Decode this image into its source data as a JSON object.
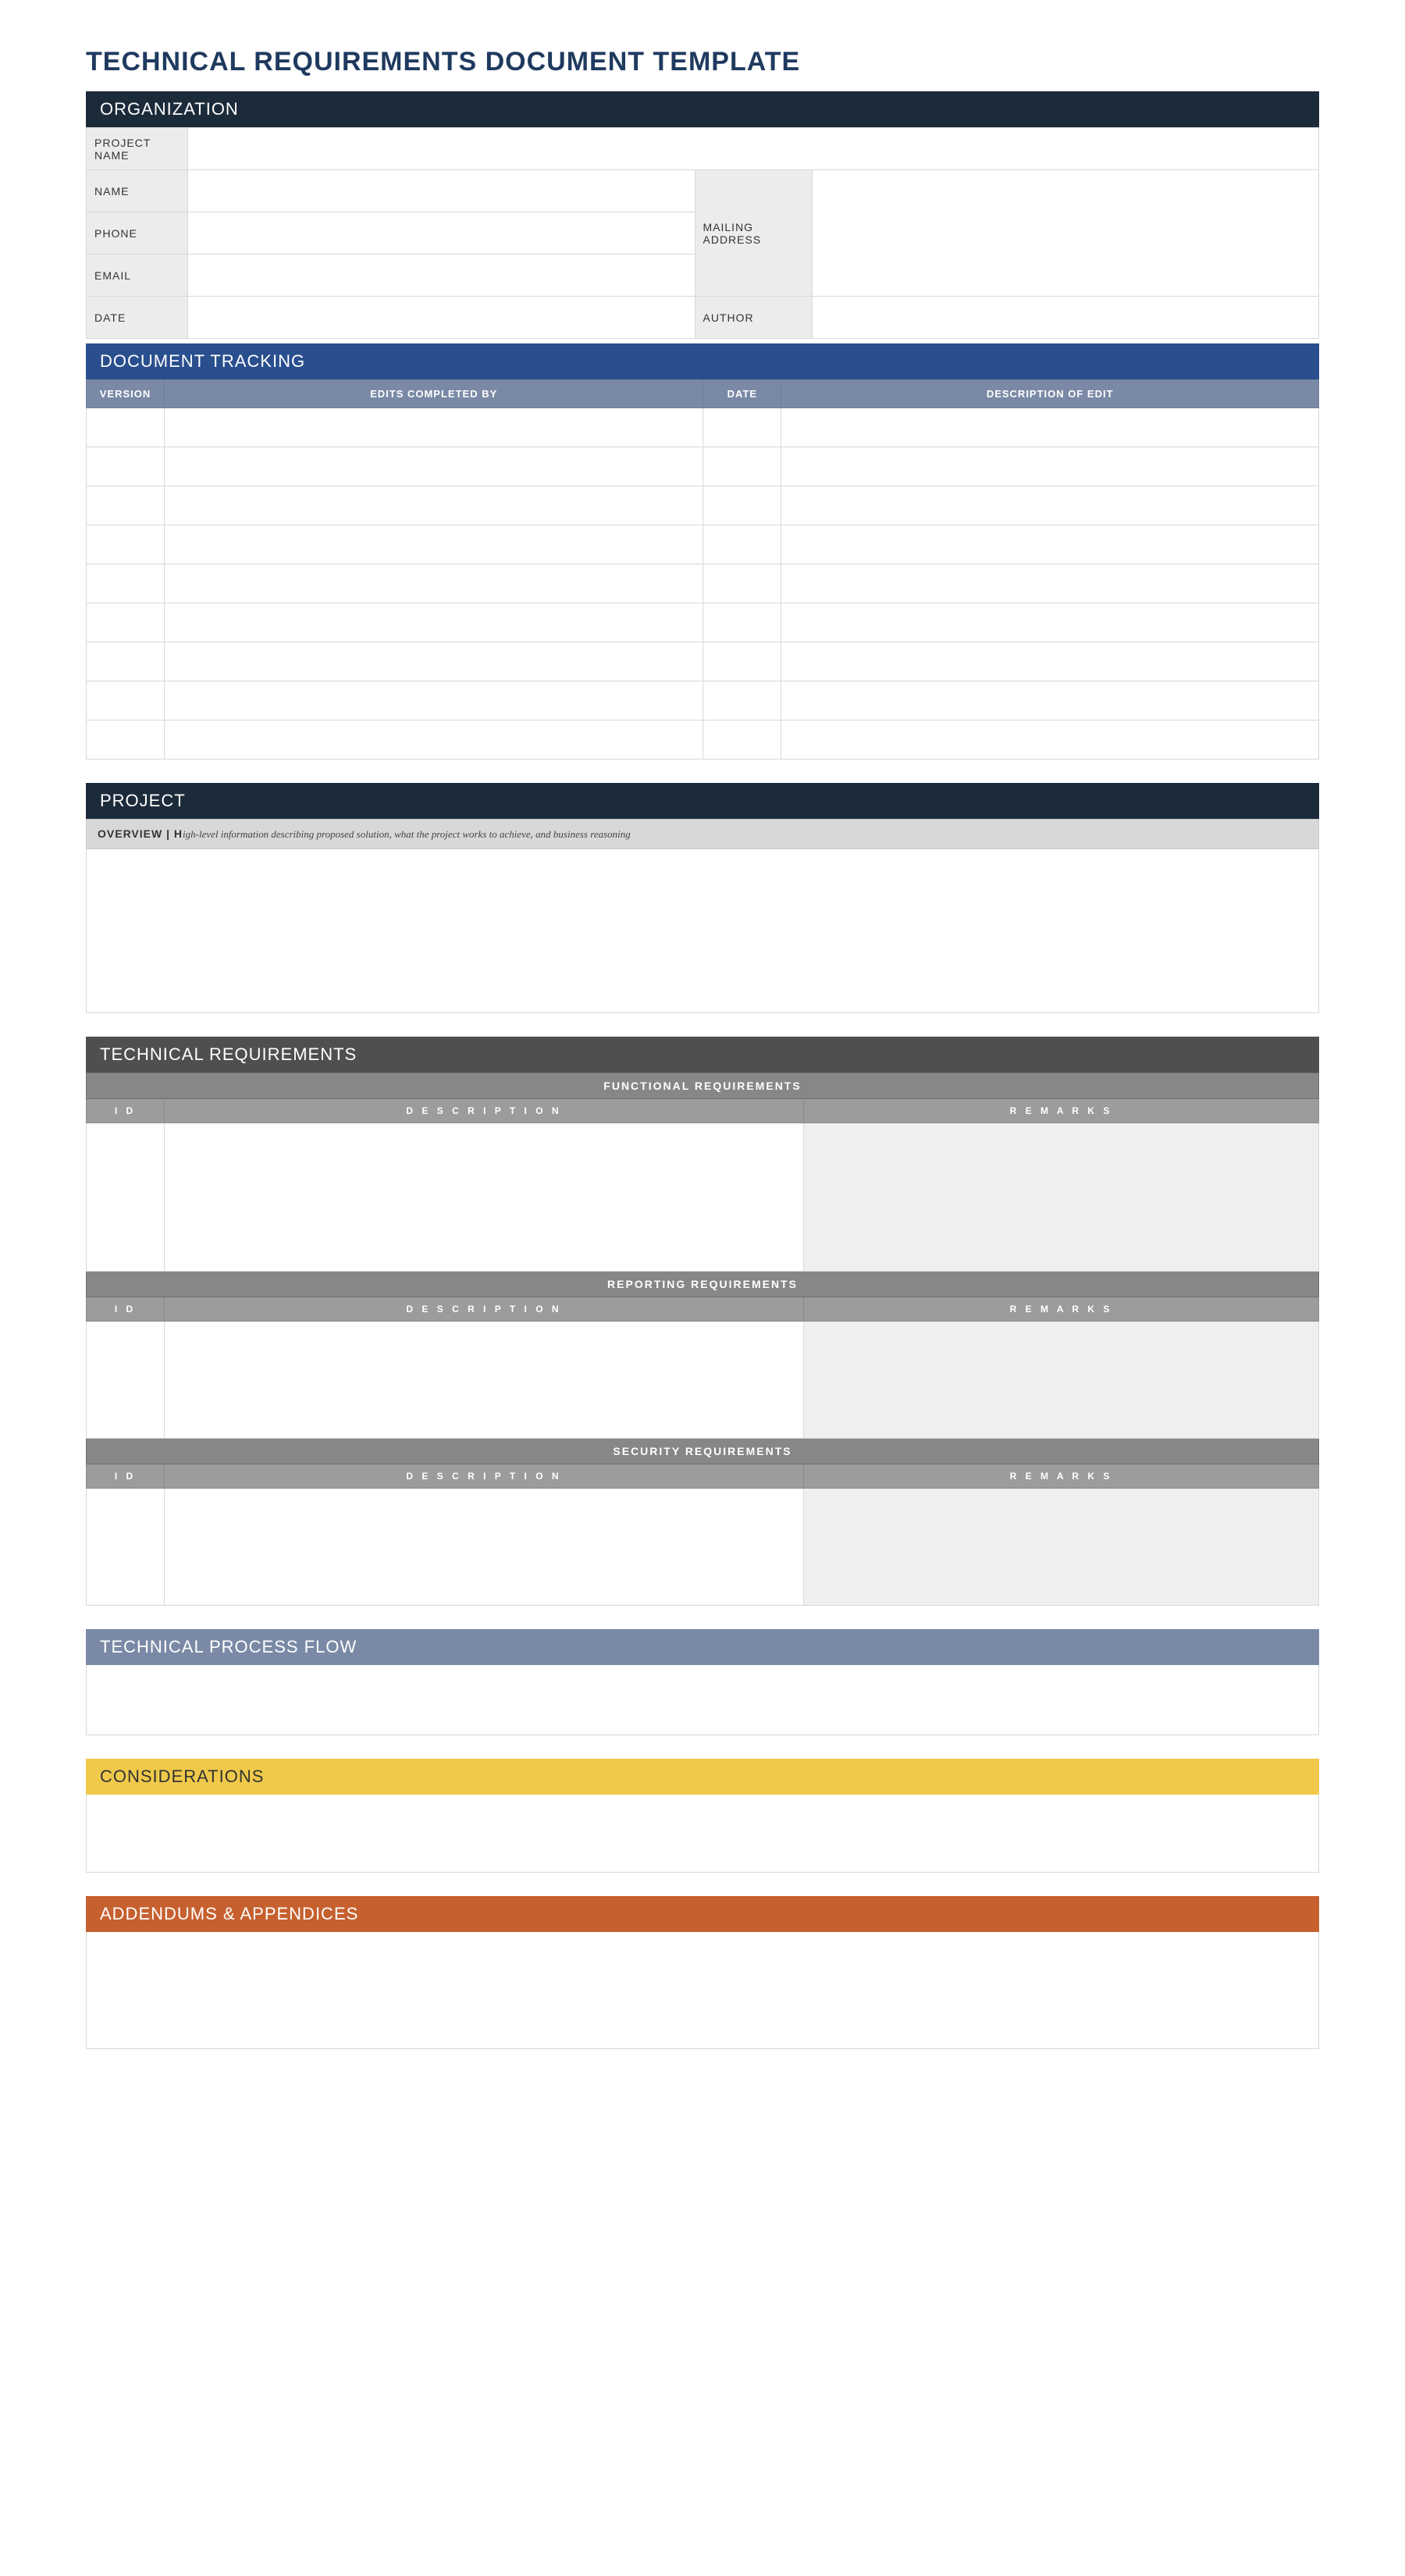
{
  "title": "TECHNICAL REQUIREMENTS DOCUMENT TEMPLATE",
  "organization": {
    "header": "ORGANIZATION",
    "labels": {
      "project_name": "PROJECT NAME",
      "name": "NAME",
      "phone": "PHONE",
      "email": "EMAIL",
      "date": "DATE",
      "mailing_address": "MAILING ADDRESS",
      "author": "AUTHOR"
    },
    "values": {
      "project_name": "",
      "name": "",
      "phone": "",
      "email": "",
      "date": "",
      "mailing_address": "",
      "author": ""
    }
  },
  "tracking": {
    "header": "DOCUMENT TRACKING",
    "columns": {
      "version": "VERSION",
      "edits_by": "EDITS COMPLETED BY",
      "date": "DATE",
      "desc": "DESCRIPTION OF EDIT"
    },
    "row_count": 9
  },
  "project": {
    "header": "PROJECT",
    "overview_label": "OVERVIEW   |   H",
    "overview_desc": "igh-level information describing proposed solution, what the project works to achieve, and business reasoning",
    "overview_value": ""
  },
  "tech_req": {
    "header": "TECHNICAL REQUIREMENTS",
    "columns": {
      "id": "I D",
      "description": "D E S C R I P T I O N",
      "remarks": "R E M A R K S"
    },
    "groups": {
      "functional": "FUNCTIONAL REQUIREMENTS",
      "reporting": "REPORTING REQUIREMENTS",
      "security": "SECURITY REQUIREMENTS"
    }
  },
  "process_flow": {
    "header": "TECHNICAL PROCESS FLOW",
    "value": ""
  },
  "considerations": {
    "header": "CONSIDERATIONS",
    "value": ""
  },
  "addendums": {
    "header": "ADDENDUMS & APPENDICES",
    "value": ""
  }
}
